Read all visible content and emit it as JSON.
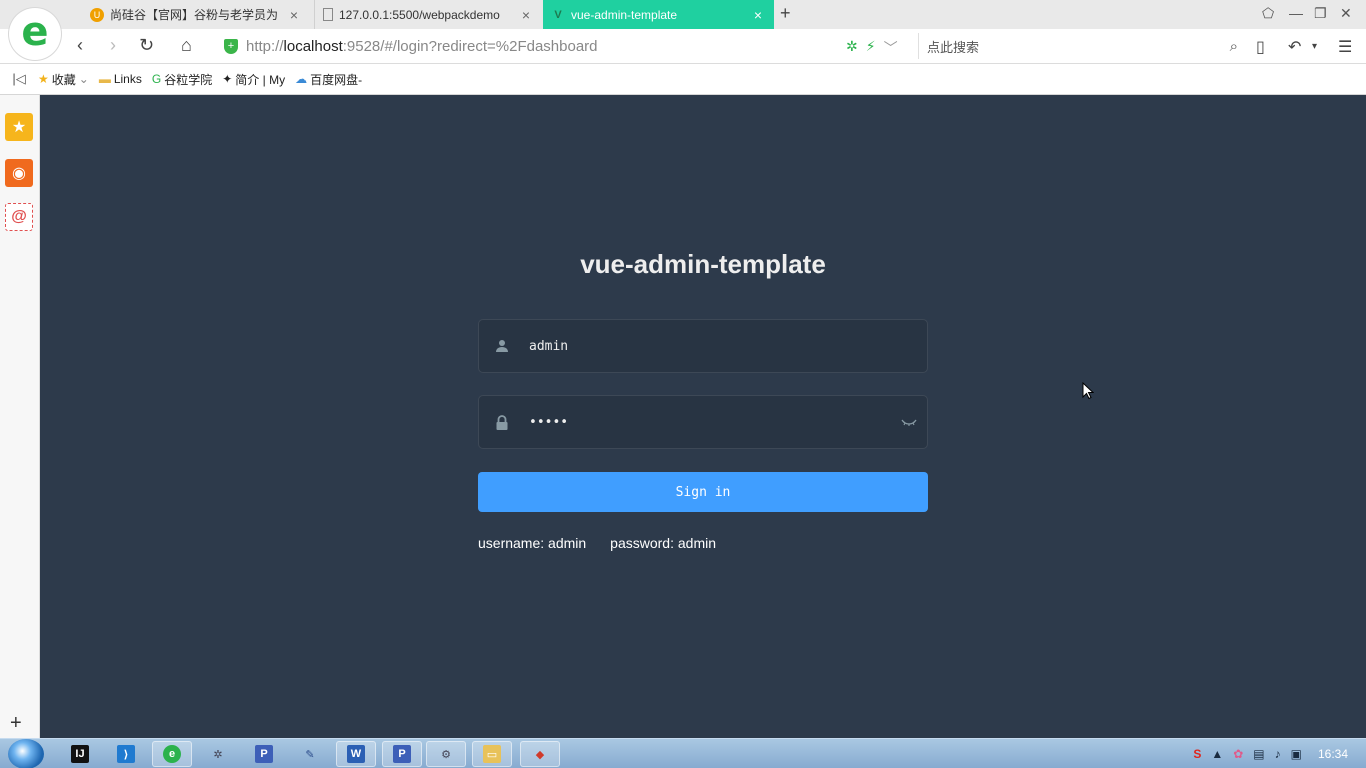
{
  "browser": {
    "tabs": [
      {
        "title": "尚硅谷【官网】谷粉与老学员为",
        "active": false
      },
      {
        "title": "127.0.0.1:5500/webpackdemo",
        "active": false
      },
      {
        "title": "vue-admin-template",
        "active": true
      }
    ],
    "url_prefix": "http://",
    "url_host": "localhost",
    "url_rest": ":9528/#/login?redirect=%2Fdashboard",
    "search_placeholder": "点此搜索",
    "bookmarks": [
      {
        "label": "收藏",
        "icon": "star-icon"
      },
      {
        "label": "Links",
        "icon": "folder-icon"
      },
      {
        "label": "谷粒学院",
        "icon": "site-icon"
      },
      {
        "label": "简介 | My",
        "icon": "bird-icon"
      },
      {
        "label": "百度网盘-",
        "icon": "cloud-icon"
      }
    ]
  },
  "login": {
    "title": "vue-admin-template",
    "username_value": "admin",
    "password_value": "•••••",
    "signin_label": "Sign in",
    "tip_username": "username: admin",
    "tip_password": "password: admin"
  },
  "taskbar": {
    "clock": "16:34"
  },
  "colors": {
    "page_bg": "#2d3a4b",
    "input_bg": "#283443",
    "button_blue": "#409eff",
    "active_tab": "#1fd0a0"
  }
}
